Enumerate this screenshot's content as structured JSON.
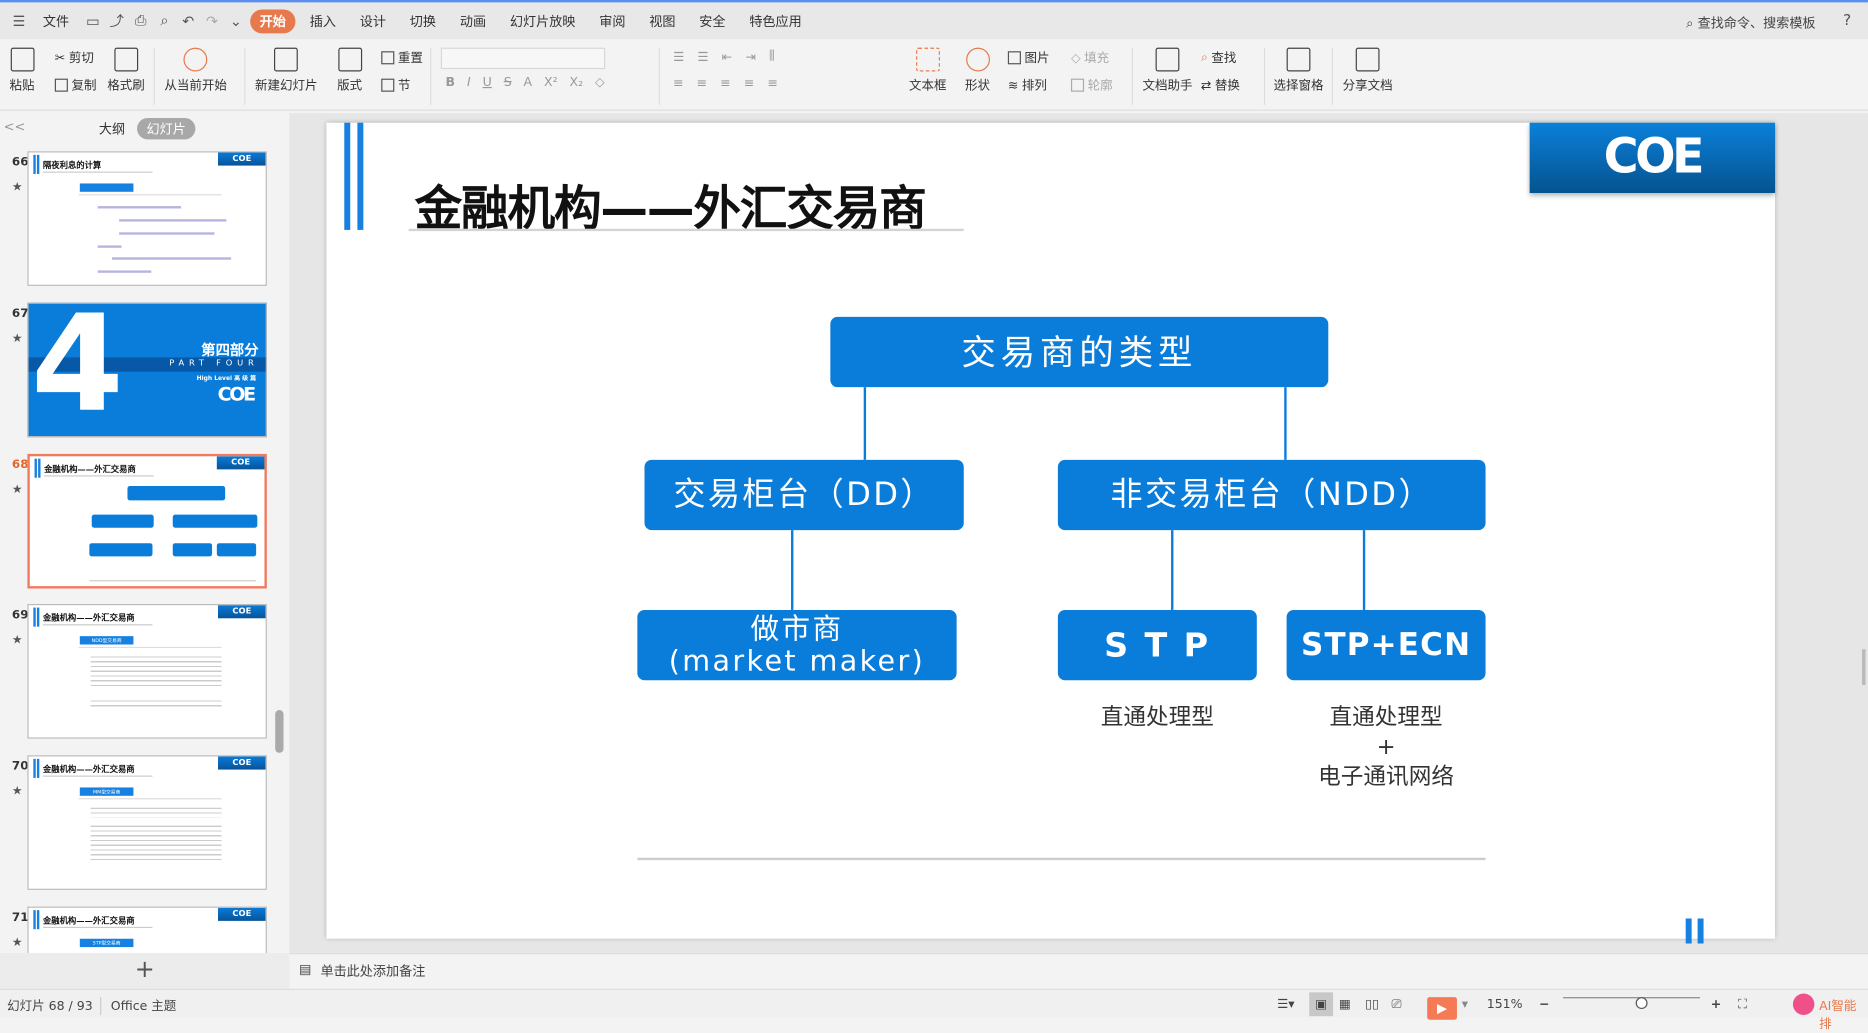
{
  "menubar": {
    "file": "文件",
    "tabs": [
      "开始",
      "插入",
      "设计",
      "切换",
      "动画",
      "幻灯片放映",
      "审阅",
      "视图",
      "安全",
      "特色应用"
    ],
    "active_tab": "开始",
    "search": "查找命令、搜索模板",
    "help": "?"
  },
  "ribbon": {
    "paste": "粘贴",
    "cut": "剪切",
    "copy": "复制",
    "format_painter": "格式刷",
    "play_from_current": "从当前开始",
    "new_slide": "新建幻灯片",
    "layout": "版式",
    "reset": "重置",
    "section": "节",
    "text_box": "文本框",
    "shape": "形状",
    "picture": "图片",
    "fill": "填充",
    "arrange": "排列",
    "outline": "轮廓",
    "doc_assistant": "文档助手",
    "find": "查找",
    "replace": "替换",
    "selection_pane": "选择窗格",
    "share": "分享文档"
  },
  "left_panel": {
    "tab_outline": "大纲",
    "tab_slides": "幻灯片",
    "collapse": "<<",
    "add": "+",
    "thumbs": [
      {
        "num": "66",
        "title": "隔夜利息的计算",
        "logo": "COE"
      },
      {
        "num": "67",
        "big": "4",
        "cn": "第四部分",
        "en": "PART FOUR",
        "level": "High Level 高 级 篇",
        "logo": "COE"
      },
      {
        "num": "68",
        "title": "金融机构——外汇交易商",
        "logo": "COE"
      },
      {
        "num": "69",
        "title": "金融机构——外汇交易商",
        "sub": "NDD型交易商",
        "logo": "COE"
      },
      {
        "num": "70",
        "title": "金融机构——外汇交易商",
        "sub": "MM型交易商",
        "logo": "COE"
      },
      {
        "num": "71",
        "title": "金融机构——外汇交易商",
        "sub": "STP型交易商",
        "logo": "COE"
      }
    ]
  },
  "slide": {
    "title": "金融机构——外汇交易商",
    "logo": "COE",
    "root": "交易商的类型",
    "dd": "交易柜台（DD）",
    "ndd": "非交易柜台（NDD）",
    "mm_line1": "做市商",
    "mm_line2": "(market maker)",
    "stp": "S T P",
    "ecn": "STP+ECN",
    "stp_label": "直通处理型",
    "ecn_label1": "直通处理型",
    "ecn_label2": "+",
    "ecn_label3": "电子通讯网络"
  },
  "notes": {
    "placeholder": "单击此处添加备注"
  },
  "status": {
    "slide_counter": "幻灯片 68 / 93",
    "theme": "Office 主题",
    "zoom": "151%",
    "ai": "AI智能排"
  }
}
